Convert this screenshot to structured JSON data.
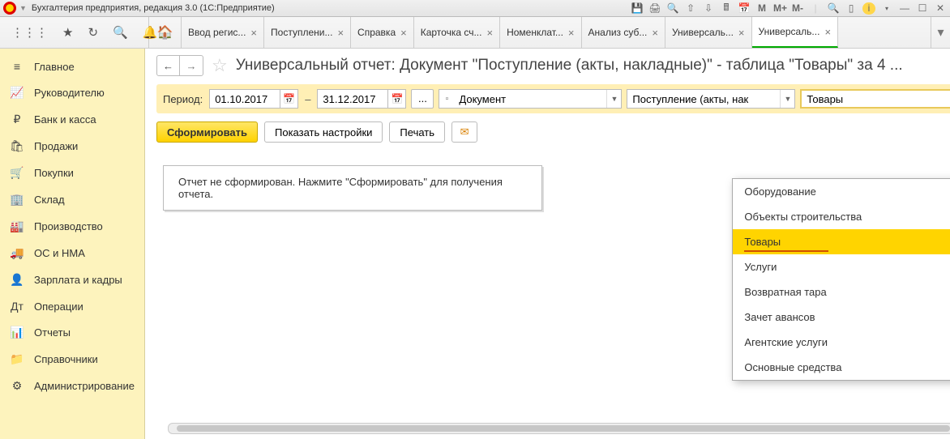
{
  "titlebar": {
    "title": "Бухгалтерия предприятия, редакция 3.0   (1С:Предприятие)"
  },
  "tabs": [
    {
      "label": "Ввод регис...",
      "active": false
    },
    {
      "label": "Поступлени...",
      "active": false
    },
    {
      "label": "Справка",
      "active": false
    },
    {
      "label": "Карточка сч...",
      "active": false
    },
    {
      "label": "Номенклат...",
      "active": false
    },
    {
      "label": "Анализ суб...",
      "active": false
    },
    {
      "label": "Универсаль...",
      "active": false
    },
    {
      "label": "Универсаль...",
      "active": true
    }
  ],
  "sidebar": [
    {
      "icon": "≡",
      "label": "Главное"
    },
    {
      "icon": "📈",
      "label": "Руководителю"
    },
    {
      "icon": "₽",
      "label": "Банк и касса"
    },
    {
      "icon": "🛍",
      "label": "Продажи"
    },
    {
      "icon": "🛒",
      "label": "Покупки"
    },
    {
      "icon": "🏢",
      "label": "Склад"
    },
    {
      "icon": "🏭",
      "label": "Производство"
    },
    {
      "icon": "🚚",
      "label": "ОС и НМА"
    },
    {
      "icon": "👤",
      "label": "Зарплата и кадры"
    },
    {
      "icon": "Дт",
      "label": "Операции"
    },
    {
      "icon": "📊",
      "label": "Отчеты"
    },
    {
      "icon": "📁",
      "label": "Справочники"
    },
    {
      "icon": "⚙",
      "label": "Администрирование"
    }
  ],
  "page": {
    "title": "Универсальный отчет: Документ \"Поступление (акты, накладные)\" - таблица \"Товары\" за 4 ..."
  },
  "filter": {
    "period_label": "Период:",
    "date_from": "01.10.2017",
    "date_to": "31.12.2017",
    "dash": "–",
    "dots": "...",
    "sel1": "Документ",
    "sel2": "Поступление (акты, нак",
    "sel3": "Товары"
  },
  "actions": {
    "generate": "Сформировать",
    "show_settings": "Показать настройки",
    "print": "Печать"
  },
  "message": "Отчет не сформирован. Нажмите \"Сформировать\" для получения отчета.",
  "dropdown": {
    "options": [
      "Оборудование",
      "Объекты строительства",
      "Товары",
      "Услуги",
      "Возвратная тара",
      "Зачет авансов",
      "Агентские услуги",
      "Основные средства"
    ],
    "selected_index": 2
  }
}
